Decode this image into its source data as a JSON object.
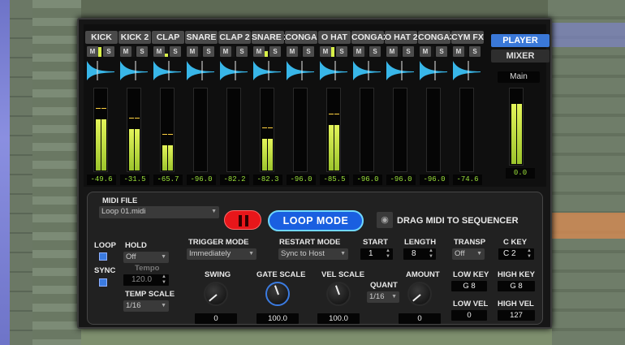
{
  "colors": {
    "accent": "#3a78d8",
    "meter": "#d8f048",
    "stop": "#e8161a",
    "loop": "#1a5fe0"
  },
  "channels": [
    {
      "name": "KICK",
      "value": "-49.6",
      "led": 0.9,
      "level": 0.62
    },
    {
      "name": "KICK 2",
      "value": "-31.5",
      "led": 0.0,
      "level": 0.5
    },
    {
      "name": "CLAP",
      "value": "-65.7",
      "led": 0.3,
      "level": 0.3
    },
    {
      "name": "SNARE",
      "value": "-96.0",
      "led": 0.0,
      "level": 0.0
    },
    {
      "name": "CLAP 2",
      "value": "-82.2",
      "led": 0.0,
      "level": 0.0
    },
    {
      "name": "SNARE 2",
      "value": "-82.3",
      "led": 0.5,
      "level": 0.38
    },
    {
      "name": "CONGA",
      "value": "-96.0",
      "led": 0.0,
      "level": 0.0
    },
    {
      "name": "O HAT",
      "value": "-85.5",
      "led": 0.9,
      "level": 0.55
    },
    {
      "name": "CONGA2",
      "value": "-96.0",
      "led": 0.0,
      "level": 0.0
    },
    {
      "name": "O HAT 2",
      "value": "-96.0",
      "led": 0.0,
      "level": 0.0
    },
    {
      "name": "CONGA3",
      "value": "-96.0",
      "led": 0.0,
      "level": 0.0
    },
    {
      "name": "CYM FX",
      "value": "-74.6",
      "led": 0.0,
      "level": 0.0
    }
  ],
  "ms_labels": {
    "mute": "M",
    "solo": "S"
  },
  "tabs": {
    "player": "PLAYER",
    "mixer": "MIXER"
  },
  "main": {
    "label": "Main",
    "value": "0.0",
    "level": 0.8
  },
  "midi": {
    "label": "MIDI FILE",
    "file": "Loop 01.midi"
  },
  "loop_mode_label": "LOOP MODE",
  "drag_label": "DRAG MIDI TO SEQUENCER",
  "loop": {
    "label": "LOOP",
    "checked": true
  },
  "sync": {
    "label": "SYNC",
    "checked": true
  },
  "hold": {
    "label": "HOLD",
    "value": "Off"
  },
  "tempo": {
    "label": "Tempo",
    "value": "120.0"
  },
  "temp_scale": {
    "label": "TEMP SCALE",
    "value": "1/16"
  },
  "trigger_mode": {
    "label": "TRIGGER MODE",
    "value": "Immediately"
  },
  "restart_mode": {
    "label": "RESTART MODE",
    "value": "Sync to Host"
  },
  "start": {
    "label": "START",
    "value": "1"
  },
  "length": {
    "label": "LENGTH",
    "value": "8"
  },
  "transp": {
    "label": "TRANSP",
    "value": "Off"
  },
  "c_key": {
    "label": "C KEY",
    "value": "C  2"
  },
  "swing": {
    "label": "SWING",
    "value": "0"
  },
  "gate_scale": {
    "label": "GATE SCALE",
    "value": "100.0"
  },
  "vel_scale": {
    "label": "VEL SCALE",
    "value": "100.0"
  },
  "quant": {
    "label": "QUANT",
    "value": "1/16"
  },
  "amount": {
    "label": "AMOUNT",
    "value": "0"
  },
  "low_key": {
    "label": "LOW KEY",
    "value": "G  8"
  },
  "high_key": {
    "label": "HIGH KEY",
    "value": "G  8"
  },
  "low_vel": {
    "label": "LOW VEL",
    "value": "0"
  },
  "high_vel": {
    "label": "HIGH VEL",
    "value": "127"
  }
}
